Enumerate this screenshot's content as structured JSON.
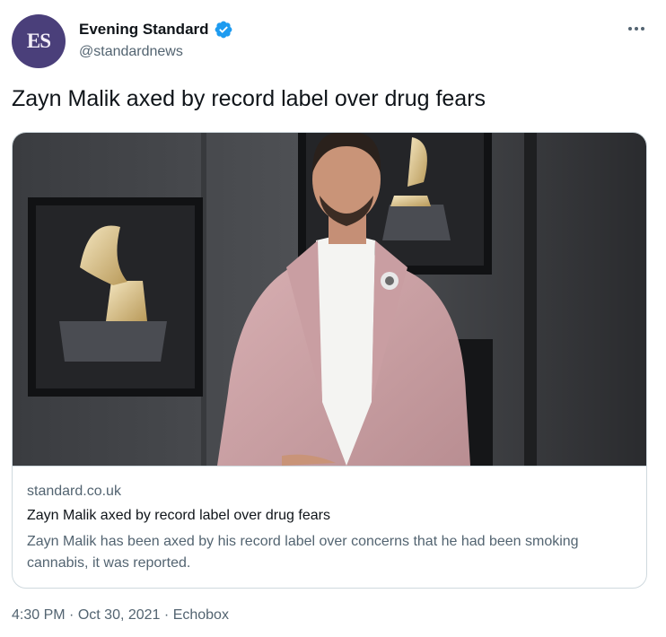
{
  "account": {
    "avatar_text": "ES",
    "name": "Evening Standard",
    "handle": "@standardnews",
    "verified": true
  },
  "tweet": {
    "text": "Zayn Malik axed by record label over drug fears"
  },
  "card": {
    "domain": "standard.co.uk",
    "title": "Zayn Malik axed by record label over drug fears",
    "description": "Zayn Malik has been axed by his record label over concerns that he had been smoking cannabis, it was reported."
  },
  "meta": {
    "time": "4:30 PM",
    "date": "Oct 30, 2021",
    "source": "Echobox",
    "separator": "·"
  },
  "icons": {
    "verified": "verified-badge-icon",
    "more": "more-options-icon"
  },
  "colors": {
    "verified": "#1d9bf0",
    "secondary_text": "#536471",
    "border": "#cfd9de",
    "avatar_bg": "#4a3f7a"
  }
}
